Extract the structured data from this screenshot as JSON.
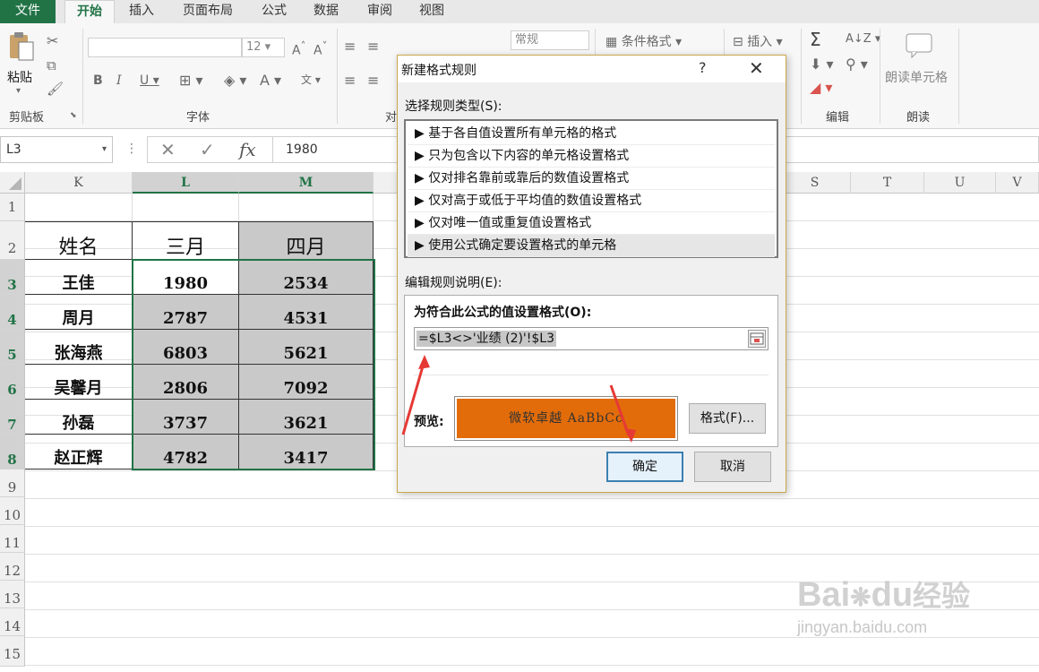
{
  "ribbon": {
    "tabs": [
      "文件",
      "开始",
      "插入",
      "页面布局",
      "公式",
      "数据",
      "审阅",
      "视图"
    ],
    "groups": [
      "剪贴板",
      "字体",
      "对",
      "编辑",
      "朗读"
    ],
    "paste_label": "粘贴",
    "font_size": "12",
    "number_format": "常规",
    "cond_format_label": "条件格式",
    "insert_label": "插入",
    "read_cell_label": "朗读单元格"
  },
  "formula_bar": {
    "name_box": "L3",
    "formula": "1980",
    "fx_label": "fx"
  },
  "sheet": {
    "columns": [
      "K",
      "L",
      "M",
      "S",
      "T",
      "U",
      "V"
    ],
    "rows": [
      "1",
      "2",
      "3",
      "4",
      "5",
      "6",
      "7",
      "8",
      "9",
      "10",
      "11",
      "12",
      "13",
      "14",
      "15"
    ],
    "header": [
      "姓名",
      "三月",
      "四月"
    ],
    "data": [
      [
        "王佳",
        "1980",
        "2534"
      ],
      [
        "周月",
        "2787",
        "4531"
      ],
      [
        "张海燕",
        "6803",
        "5621"
      ],
      [
        "吴馨月",
        "2806",
        "7092"
      ],
      [
        "孙磊",
        "3737",
        "3621"
      ],
      [
        "赵正辉",
        "4782",
        "3417"
      ]
    ]
  },
  "dialog": {
    "title": "新建格式规则",
    "help": "?",
    "select_type_label": "选择规则类型(S):",
    "rule_types": [
      "基于各自值设置所有单元格的格式",
      "只为包含以下内容的单元格设置格式",
      "仅对排名靠前或靠后的数值设置格式",
      "仅对高于或低于平均值的数值设置格式",
      "仅对唯一值或重复值设置格式",
      "使用公式确定要设置格式的单元格"
    ],
    "selected_rule_index": 5,
    "edit_desc_label": "编辑规则说明(E):",
    "formula_label": "为符合此公式的值设置格式(O):",
    "formula_value": "=$L3<>'业绩 (2)'!$L3",
    "preview_label": "预览:",
    "preview_text": "微软卓越  AaBbCc",
    "preview_color": "#e36c0a",
    "format_button": "格式(F)...",
    "ok_button": "确定",
    "cancel_button": "取消"
  },
  "watermark": {
    "brand": "Bai",
    "brand2": "du",
    "brand3": "经验",
    "url": "jingyan.baidu.com"
  }
}
